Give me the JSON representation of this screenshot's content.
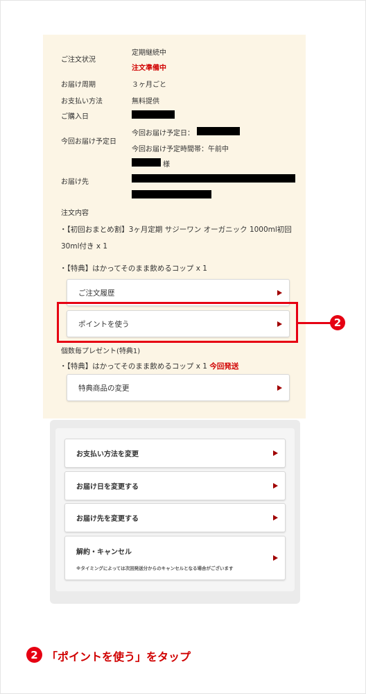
{
  "order": {
    "status_label": "ご注文状況",
    "status_value_1": "定期継続中",
    "status_value_2": "注文準備中",
    "cycle_label": "お届け周期",
    "cycle_value": "３ヶ月ごと",
    "payment_label": "お支払い方法",
    "payment_value": "無料提供",
    "purchase_date_label": "ご購入日",
    "delivery_label": "今回お届け予定日",
    "delivery_date_label": "今回お届け予定日：",
    "delivery_time": "今回お届け予定時間帯：午前中",
    "recipient_suffix": "様",
    "address_label": "お届け先",
    "contents_label": "注文内容",
    "item_line_1": "・【初回おまとめ割】3ヶ月定期 サジーワン オーガニック 1000ml初回",
    "item_line_2": "30ml付き x 1",
    "bonus_line": "・【特典】はかってそのまま飲めるコップ x 1",
    "gift_heading": "個数毎プレゼント(特典1)",
    "gift_line": "・【特典】はかってそのまま飲めるコップ x 1",
    "gift_status": "今回発送"
  },
  "buttons": {
    "order_history": "ご注文履歴",
    "use_points": "ポイントを使う",
    "change_bonus": "特典商品の変更",
    "change_payment": "お支払い方法を変更",
    "change_date": "お届け日を変更する",
    "change_address": "お届け先を変更する",
    "cancel": "解約・キャンセル",
    "cancel_note": "※タイミングによっては次回発送分からのキャンセルとなる場合がございます"
  },
  "annotation": {
    "number": "2",
    "caption": "「ポイントを使う」をタップ",
    "accent_color": "#e60012"
  }
}
